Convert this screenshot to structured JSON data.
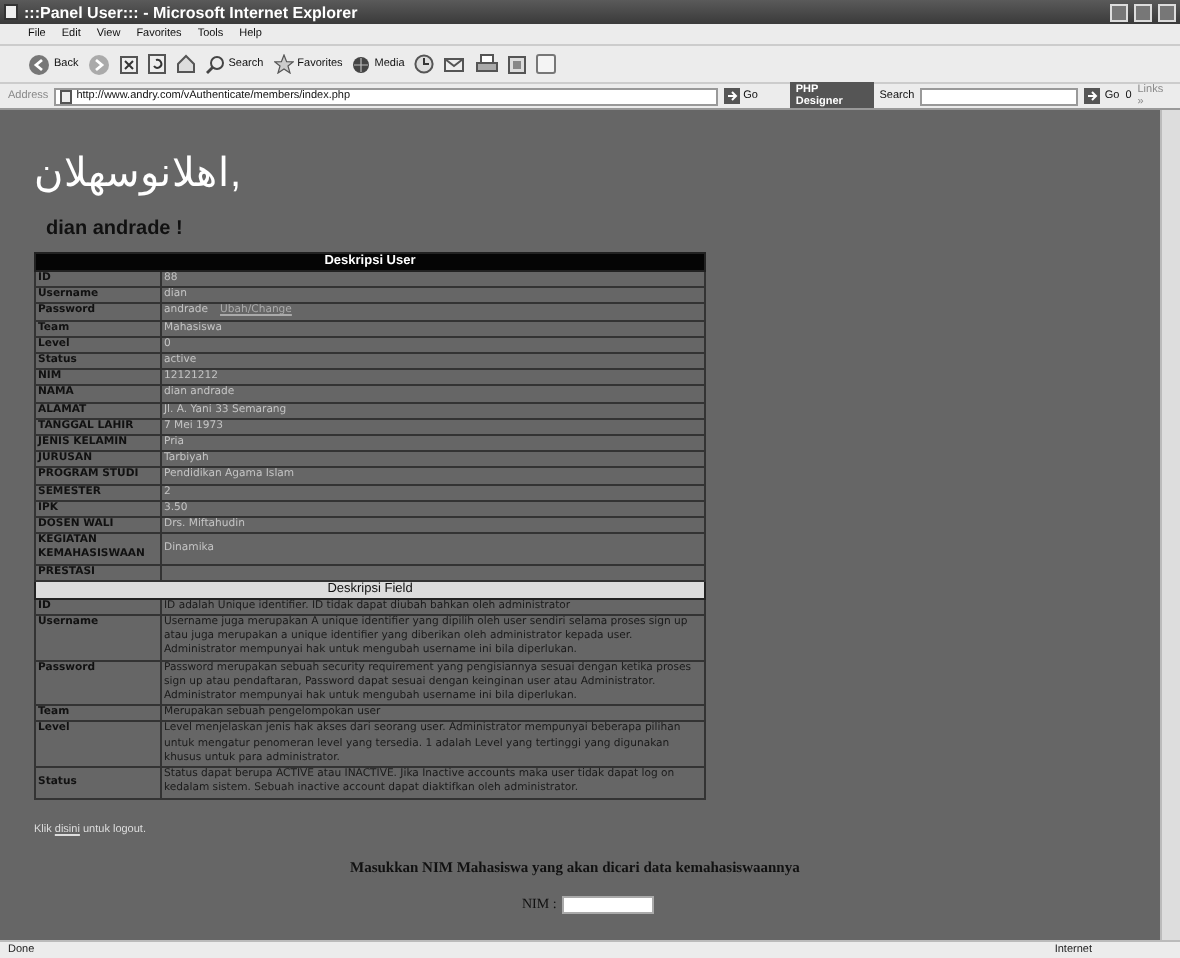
{
  "window": {
    "title": ":::Panel User::: - Microsoft Internet Explorer"
  },
  "menu": [
    "File",
    "Edit",
    "View",
    "Favorites",
    "Tools",
    "Help"
  ],
  "toolbar": [
    {
      "kind": "back",
      "label": "Back"
    },
    {
      "kind": "forward"
    },
    {
      "kind": "stop"
    },
    {
      "kind": "refresh"
    },
    {
      "kind": "home"
    },
    {
      "kind": "search",
      "label": "Search"
    },
    {
      "kind": "favorites",
      "label": "Favorites"
    },
    {
      "kind": "media",
      "label": "Media"
    },
    {
      "kind": "history"
    },
    {
      "kind": "mail"
    },
    {
      "kind": "print"
    },
    {
      "kind": "edit"
    },
    {
      "kind": "discuss"
    }
  ],
  "address": {
    "label": "Address",
    "url": "http://www.andry.com/vAuthenticate/members/index.php",
    "go": "Go"
  },
  "links_bar": {
    "brand": "PHP Designer",
    "search": "Search",
    "go": "Go",
    "count": "0",
    "links": "Links »"
  },
  "greeting": "اهلانوسهلان,",
  "user_name": "dian andrade !",
  "user_table": {
    "title": "Deskripsi User",
    "rows": [
      {
        "label": "ID",
        "value": "88"
      },
      {
        "label": "Username",
        "value": "dian"
      },
      {
        "label": "Password",
        "value": "andrade",
        "link": "Ubah/Change"
      },
      {
        "label": "Team",
        "value": "Mahasiswa"
      },
      {
        "label": "Level",
        "value": "0"
      },
      {
        "label": "Status",
        "value": "active"
      },
      {
        "label": "NIM",
        "value": "12121212"
      },
      {
        "label": "NAMA",
        "value": "dian andrade"
      },
      {
        "label": "ALAMAT",
        "value": "Jl. A. Yani 33 Semarang"
      },
      {
        "label": "TANGGAL LAHIR",
        "value": "7 Mei 1973"
      },
      {
        "label": "JENIS KELAMIN",
        "value": "Pria"
      },
      {
        "label": "JURUSAN",
        "value": "Tarbiyah"
      },
      {
        "label": "PROGRAM STUDI",
        "value": "Pendidikan Agama Islam"
      },
      {
        "label": "SEMESTER",
        "value": "2"
      },
      {
        "label": "IPK",
        "value": "3.50"
      },
      {
        "label": "DOSEN WALI",
        "value": "Drs. Miftahudin"
      },
      {
        "label": "KEGIATAN KEMAHASISWAAN",
        "value": "Dinamika"
      },
      {
        "label": "PRESTASI"
      }
    ]
  },
  "field_table": {
    "title": "Deskripsi Field",
    "rows": [
      {
        "label": "ID",
        "description": "ID adalah Unique identifier. ID tidak dapat diubah bahkan oleh administrator"
      },
      {
        "label": "Username",
        "description": "Username juga merupakan A unique identifier yang dipilih oleh user sendiri selama proses sign up atau juga merupakan a unique identifier yang diberikan oleh administrator kepada user. Administrator mempunyai hak untuk mengubah username ini bila diperlukan."
      },
      {
        "label": "Password",
        "description": "Password merupakan sebuah security requirement yang pengisiannya sesuai dengan ketika proses sign up atau pendaftaran, Password dapat sesuai dengan keinginan user atau Administrator. Administrator mempunyai hak untuk mengubah username ini bila diperlukan."
      },
      {
        "label": "Team",
        "description": "Merupakan sebuah pengelompokan user"
      },
      {
        "label": "Level",
        "description": "Level menjelaskan jenis hak akses dari seorang user. Administrator mempunyai beberapa pilihan untuk mengatur penomeran level yang tersedia. 1 adalah Level yang tertinggi yang digunakan khusus untuk para administrator."
      },
      {
        "label": "Status",
        "description": "Status dapat berupa ACTIVE atau INACTIVE. Jika Inactive accounts maka user tidak dapat log on kedalam sistem. Sebuah inactive account dapat diaktifkan oleh administrator."
      }
    ]
  },
  "logout": {
    "before": "Klik",
    "link": "disini",
    "after": "untuk logout."
  },
  "search_prompt": "Masukkan NIM Mahasiswa yang akan dicari data kemahasiswaannya",
  "nim_label": "NIM :",
  "status_bar": {
    "left": "Done",
    "right": "Internet"
  }
}
